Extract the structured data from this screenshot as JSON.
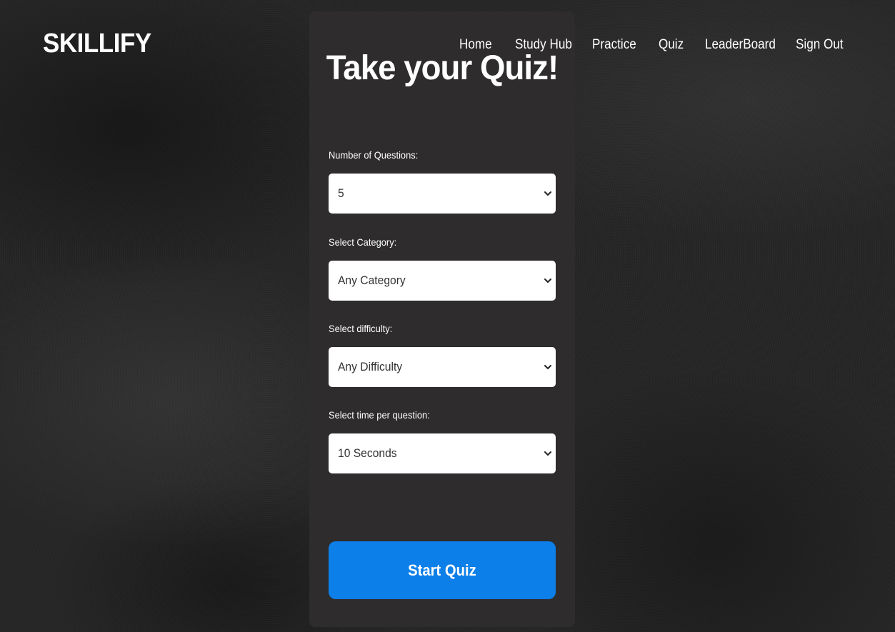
{
  "brand": {
    "logo": "SKILLIFY"
  },
  "nav": {
    "items": [
      "Home",
      "Study Hub",
      "Practice",
      "Quiz",
      "LeaderBoard",
      "Sign Out"
    ]
  },
  "quiz_form": {
    "title": "Take your Quiz!",
    "fields": [
      {
        "label": "Number of Questions:",
        "value": "5"
      },
      {
        "label": "Select Category:",
        "value": "Any Category"
      },
      {
        "label": "Select difficulty:",
        "value": "Any Difficulty"
      },
      {
        "label": "Select time per question:",
        "value": "10 Seconds"
      }
    ],
    "submit_label": "Start Quiz"
  },
  "colors": {
    "background": "#262626",
    "card": "#2e2c2d",
    "primary_button": "#0d7fe8",
    "text": "#ffffff",
    "select_text": "#333333"
  },
  "icons": {
    "select_arrow": "chevron-down-icon"
  }
}
